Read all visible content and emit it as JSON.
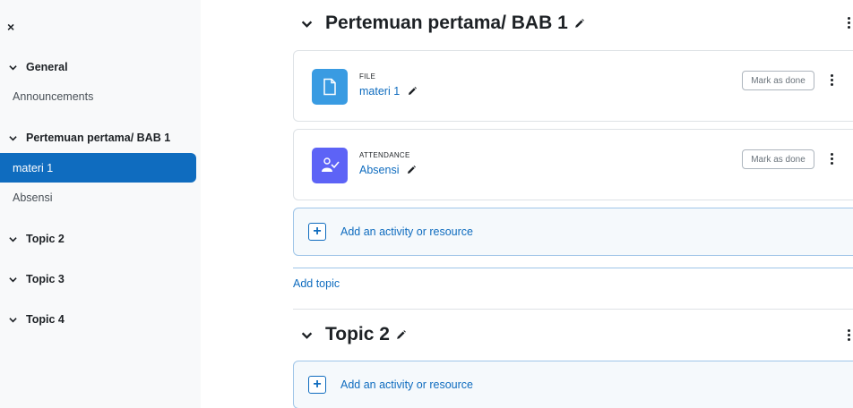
{
  "sidebar": {
    "close_icon": "×",
    "sections": [
      {
        "label": "General"
      },
      {
        "label": "Pertemuan pertama/ BAB 1"
      },
      {
        "label": "Topic 2"
      },
      {
        "label": "Topic 3"
      },
      {
        "label": "Topic 4"
      }
    ],
    "items": [
      {
        "label": "Announcements"
      },
      {
        "label": "materi 1",
        "active": true
      },
      {
        "label": "Absensi"
      }
    ],
    "active_color": "#0f6cbf"
  },
  "main": {
    "section1": {
      "title": "Pertemuan pertama/ BAB 1",
      "activities": [
        {
          "type": "FILE",
          "name": "materi 1",
          "icon": "file-icon",
          "icon_color": "#399be2",
          "mark_label": "Mark as done"
        },
        {
          "type": "ATTENDANCE",
          "name": "Absensi",
          "icon": "attendance-icon",
          "icon_color": "#5d63f6",
          "mark_label": "Mark as done"
        }
      ],
      "add_label": "Add an activity or resource",
      "plus": "+"
    },
    "add_topic_label": "Add topic",
    "section2": {
      "title": "Topic 2",
      "add_label": "Add an activity or resource",
      "plus": "+"
    }
  },
  "colors": {
    "link": "#0f6cbf",
    "border": "#dee2e6",
    "add_border": "#9fc5e8"
  }
}
